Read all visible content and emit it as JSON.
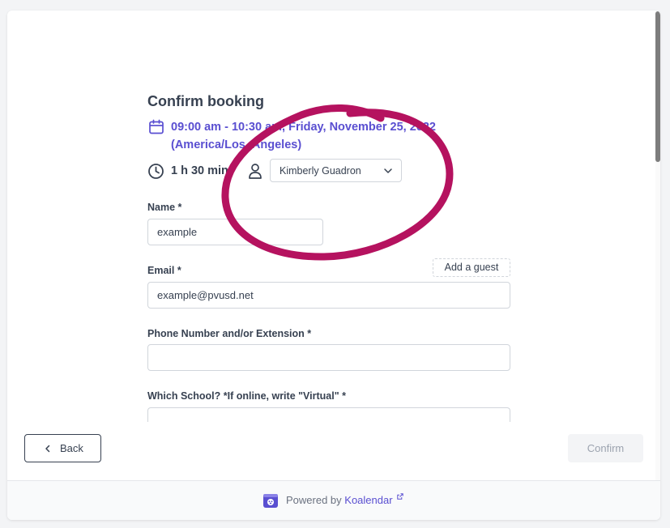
{
  "booking": {
    "title": "Confirm booking",
    "datetime_line1": "09:00 am - 10:30 am, Friday, November 25, 2022",
    "datetime_line2": "(America/Los_Angeles)",
    "duration": "1 h 30 min",
    "host": "Kimberly Guadron"
  },
  "form": {
    "name_label": "Name *",
    "name_value": "example",
    "email_label": "Email *",
    "email_value": "example@pvusd.net",
    "add_guest": "Add a guest",
    "phone_label": "Phone Number and/or Extension *",
    "phone_value": "",
    "school_label": "Which School? *If online, write \"Virtual\" *",
    "school_value": ""
  },
  "actions": {
    "back": "Back",
    "confirm": "Confirm"
  },
  "footer": {
    "powered_by": "Powered by",
    "brand": "Koalendar"
  },
  "colors": {
    "accent": "#5a4fd1",
    "annotation": "#b5125f"
  },
  "icons": [
    "calendar-icon",
    "clock-icon",
    "person-icon",
    "chevron-down-icon",
    "chevron-left-icon",
    "koalendar-logo-icon",
    "external-link-icon"
  ]
}
